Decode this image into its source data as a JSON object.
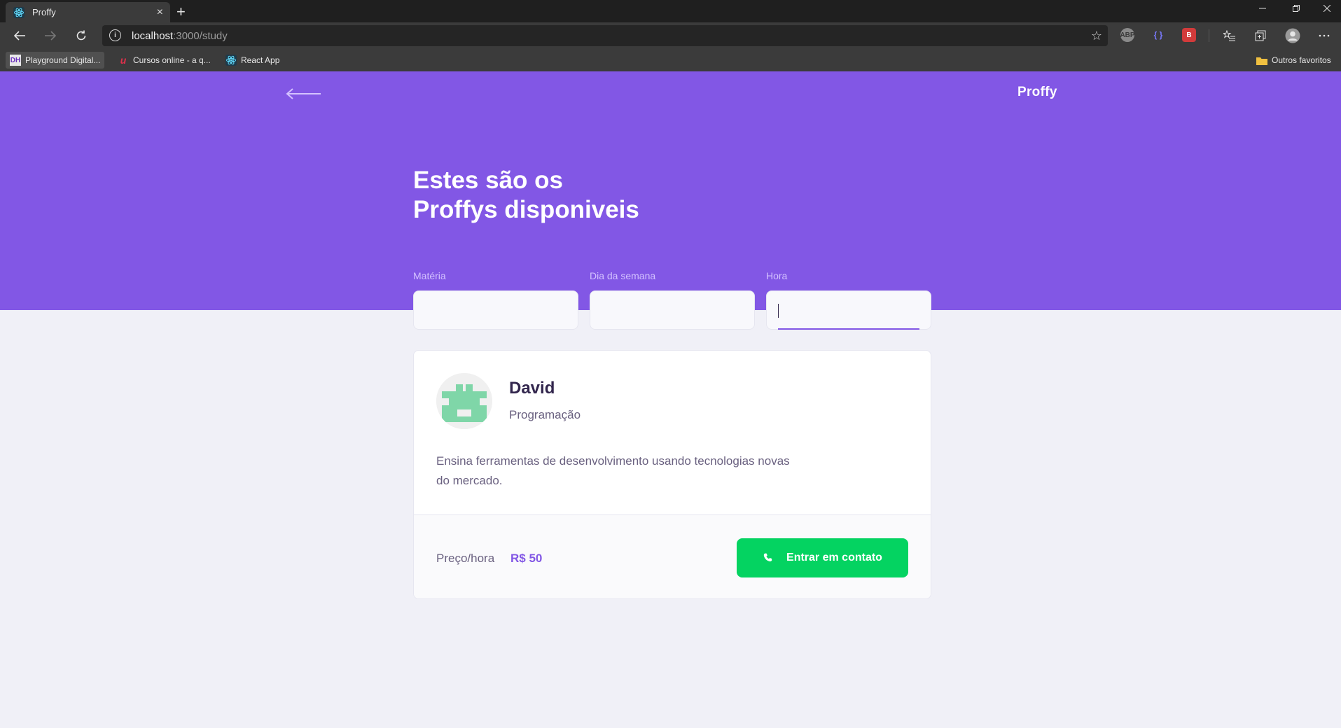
{
  "browser": {
    "tab_title": "Proffy",
    "tab_close": "×",
    "new_tab": "+",
    "url_host": "localhost",
    "url_path": ":3000/study",
    "bookmarks": [
      {
        "label": "Playground Digital...",
        "icon": "DH"
      },
      {
        "label": "Cursos online - a q...",
        "icon": "u"
      },
      {
        "label": "React App",
        "icon": "react"
      }
    ],
    "other_favorites": "Outros favoritos",
    "extensions": [
      "ABP",
      "{ }",
      "B"
    ]
  },
  "header": {
    "logo": "Proffy",
    "title_line1": "Estes são os",
    "title_line2": "Proffys disponiveis"
  },
  "filters": {
    "subject_label": "Matéria",
    "weekday_label": "Dia da semana",
    "time_label": "Hora",
    "subject_value": "",
    "weekday_value": "",
    "time_value": ""
  },
  "teacher": {
    "name": "David",
    "subject": "Programação",
    "bio": "Ensina ferramentas de desenvolvimento usando tecnologias novas do mercado.",
    "price_label": "Preço/hora",
    "price_value": "R$ 50",
    "contact_label": "Entrar em contato"
  },
  "colors": {
    "primary": "#8257E5",
    "secondary": "#04D361",
    "background": "#F0F0F7"
  }
}
